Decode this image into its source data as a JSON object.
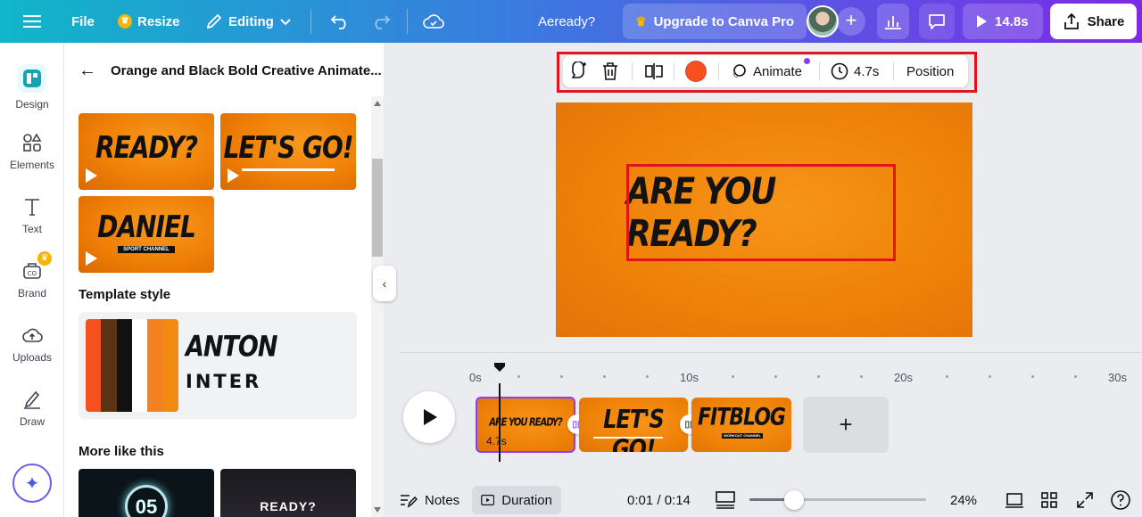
{
  "topbar": {
    "file": "File",
    "resize": "Resize",
    "editing": "Editing",
    "title": "Aeready?",
    "upgrade": "Upgrade to Canva Pro",
    "play_time": "14.8s",
    "share": "Share",
    "icons": [
      "menu-icon",
      "crown-icon",
      "pencil-icon",
      "chevron-down-icon",
      "undo-icon",
      "redo-icon",
      "cloud-icon",
      "plus-icon",
      "analytics-icon",
      "comment-icon",
      "play-icon",
      "upload-icon"
    ]
  },
  "rail": {
    "items": [
      {
        "label": "Design",
        "icon": "design-icon"
      },
      {
        "label": "Elements",
        "icon": "shapes-icon"
      },
      {
        "label": "Text",
        "icon": "text-icon"
      },
      {
        "label": "Brand",
        "icon": "brand-icon"
      },
      {
        "label": "Uploads",
        "icon": "cloud-upload-icon"
      },
      {
        "label": "Draw",
        "icon": "draw-icon"
      }
    ]
  },
  "panel": {
    "title": "Orange and Black Bold Creative Animate...",
    "thumbs": [
      {
        "text": "READY?"
      },
      {
        "text": "LET'S GO!"
      },
      {
        "text": "DANIEL",
        "badge": "SPORT CHANNEL"
      }
    ],
    "template_style_label": "Template style",
    "font_primary": "ANTON",
    "font_secondary": "INTER",
    "palette": [
      "#f4511e",
      "#5a3216",
      "#111111",
      "#ffffff",
      "#f58220",
      "#ef8a12"
    ],
    "more_like_this": "More like this",
    "more_thumbs": [
      {
        "text": "05"
      },
      {
        "text": "READY?"
      }
    ]
  },
  "context_toolbar": {
    "animate": "Animate",
    "duration": "4.7s",
    "position": "Position",
    "color": "#f4511e"
  },
  "canvas": {
    "text": "ARE YOU READY?"
  },
  "timeline": {
    "ticks": [
      "0s",
      "10s",
      "20s",
      "30s"
    ],
    "clips": [
      {
        "text": "ARE YOU READY?",
        "duration": "4.7s"
      },
      {
        "text": "LET'S GO!"
      },
      {
        "text": "FITBLOG",
        "badge": "WORKOUT CHANNEL"
      }
    ],
    "add": "+"
  },
  "bottombar": {
    "notes": "Notes",
    "duration": "Duration",
    "time": "0:01 / 0:14",
    "zoom": "24%",
    "zoom_level": 0.24
  }
}
